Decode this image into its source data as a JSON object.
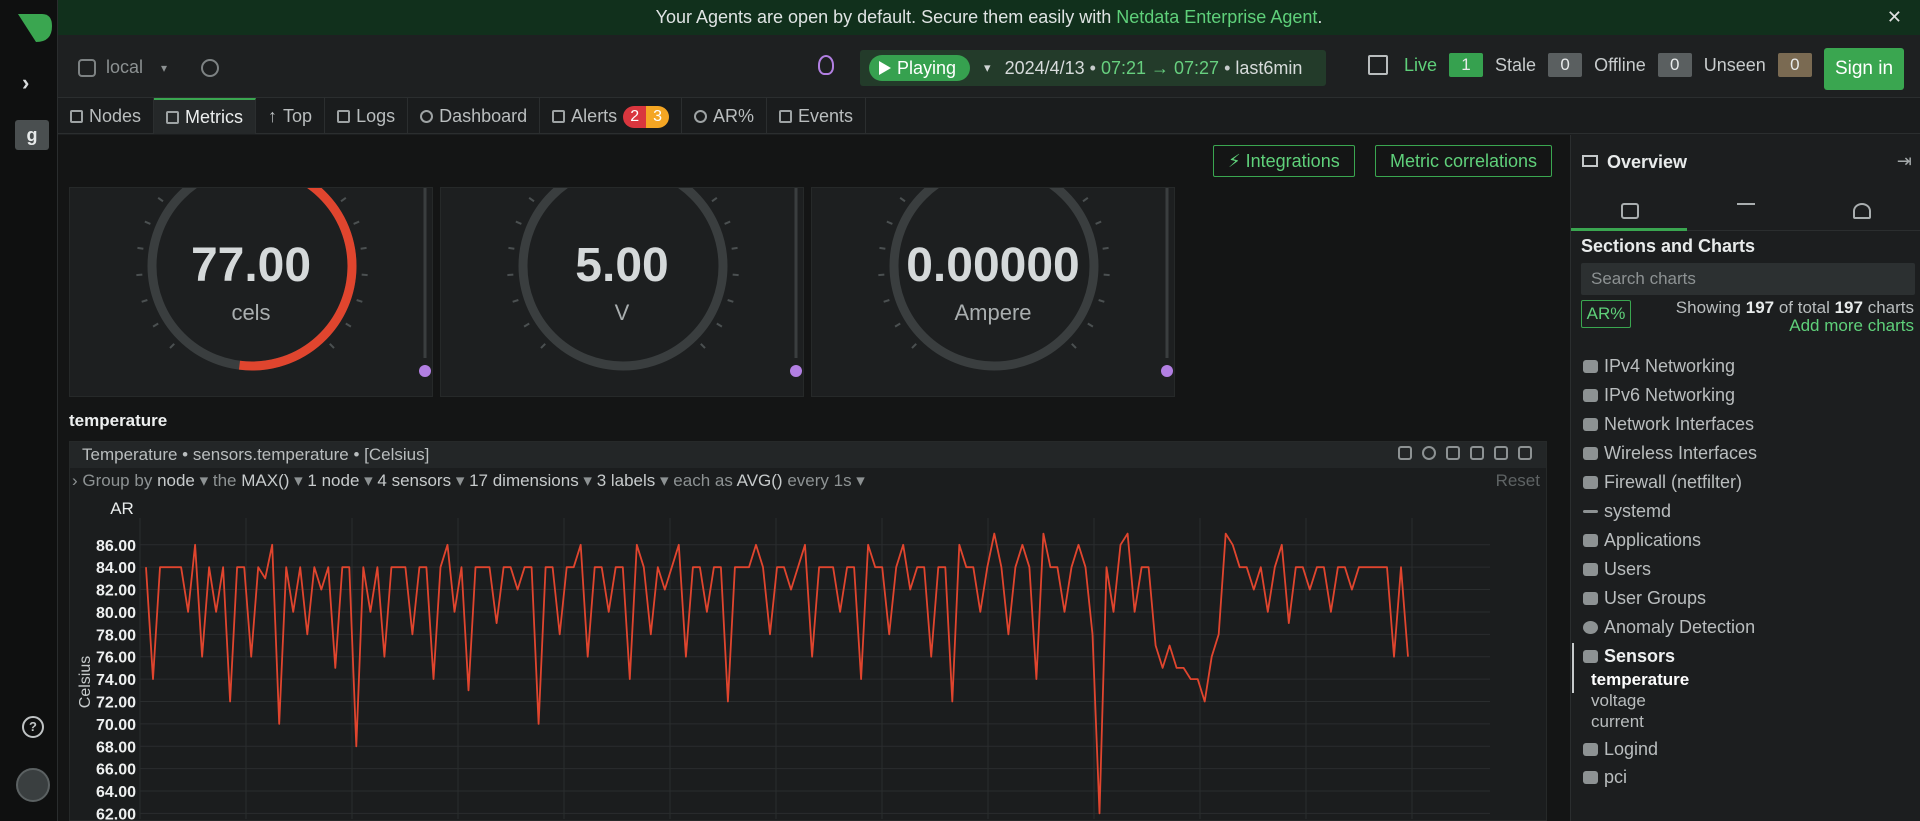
{
  "banner": {
    "text": "Your Agents are open by default. Secure them easily with ",
    "link": "Netdata Enterprise Agent",
    "suffix": ".",
    "close": "✕"
  },
  "rail": {
    "space_letter": "g",
    "help": "?"
  },
  "header": {
    "node_selector": "local",
    "play_label": "Playing",
    "date": "2024/4/13",
    "time_range": "07:21 → 07:27",
    "duration": "last6min",
    "status": [
      {
        "label": "Live",
        "count": "1",
        "color": "#36a14f"
      },
      {
        "label": "Stale",
        "count": "0",
        "color": "#5a5f60"
      },
      {
        "label": "Offline",
        "count": "0",
        "color": "#5a5f60"
      },
      {
        "label": "Unseen",
        "count": "0",
        "color": "#7a6a52"
      }
    ],
    "signin": "Sign in"
  },
  "tabs": [
    {
      "label": "Nodes"
    },
    {
      "label": "Metrics"
    },
    {
      "label": "Top"
    },
    {
      "label": "Logs"
    },
    {
      "label": "Dashboard"
    },
    {
      "label": "Alerts"
    },
    {
      "label": "AR%"
    },
    {
      "label": "Events"
    }
  ],
  "alerts": {
    "critical": "2",
    "warning": "3"
  },
  "toolbar": {
    "integrations": "Integrations",
    "metric_correlations": "Metric correlations"
  },
  "gauges": [
    {
      "value": "77.00",
      "unit": "cels",
      "fill": 0.52,
      "color": "#e0452e"
    },
    {
      "value": "5.00",
      "unit": "V",
      "fill": 0,
      "color": "#e0452e"
    },
    {
      "value": "0.00000",
      "unit": "Ampere",
      "fill": 0,
      "color": "#e0452e"
    }
  ],
  "section": "temperature",
  "chart": {
    "title": "Temperature • sensors.temperature • [Celsius]",
    "group": {
      "prefix": "Group by",
      "by": "node",
      "the": "the",
      "agg": "MAX()",
      "nodes": "1 node",
      "sensors": "4 sensors",
      "dims": "17 dimensions",
      "labels": "3 labels",
      "each": "each as",
      "avg": "AVG()",
      "every": "every 1s",
      "reset": "Reset"
    },
    "ar": "AR",
    "ylabel": "Celsius"
  },
  "chart_data": {
    "type": "line",
    "title": "Temperature • sensors.temperature • [Celsius]",
    "ylabel": "Celsius",
    "yticks": [
      "86.00",
      "84.00",
      "82.00",
      "80.00",
      "78.00",
      "76.00",
      "74.00",
      "72.00",
      "70.00",
      "68.00",
      "66.00",
      "64.00",
      "62.00"
    ],
    "ylim": [
      61.5,
      87.5
    ],
    "color": "#e0452e",
    "series": [
      {
        "values": [
          84,
          74,
          84,
          84,
          84,
          84,
          80,
          86,
          76,
          84,
          80,
          84,
          72,
          84,
          84,
          76,
          84,
          83,
          86,
          70,
          84,
          80,
          84,
          78,
          84,
          82,
          84,
          75,
          84,
          84,
          68,
          84,
          80,
          84,
          76,
          84,
          84,
          84,
          78,
          84,
          84,
          74,
          84,
          86,
          80,
          84,
          73,
          84,
          84,
          84,
          79,
          84,
          84,
          82,
          84,
          84,
          70,
          84,
          84,
          78,
          84,
          84,
          86,
          76,
          84,
          84,
          80,
          84,
          84,
          74,
          86,
          84,
          78,
          84,
          82,
          84,
          86,
          76,
          84,
          84,
          80,
          84,
          84,
          72,
          84,
          84,
          84,
          86,
          84,
          78,
          84,
          84,
          82,
          84,
          86,
          76,
          84,
          84,
          84,
          80,
          84,
          84,
          74,
          86,
          84,
          84,
          78,
          84,
          86,
          82,
          84,
          84,
          76,
          84,
          84,
          72,
          86,
          84,
          84,
          80,
          84,
          87,
          84,
          78,
          84,
          86,
          84,
          74,
          87,
          84,
          84,
          80,
          84,
          86,
          84,
          78,
          62,
          84,
          80,
          86,
          87,
          80,
          84,
          84,
          77,
          75,
          77,
          75,
          75,
          74,
          74,
          72,
          76,
          78,
          87,
          86,
          84,
          84,
          82,
          84,
          80,
          84,
          86,
          79,
          84,
          84,
          82,
          84,
          84,
          80,
          84,
          84,
          82,
          84,
          84,
          84,
          84,
          84,
          76,
          84,
          76
        ]
      }
    ]
  },
  "panel": {
    "title": "Overview",
    "collapse": "⇥",
    "sections_title": "Sections and Charts",
    "search_placeholder": "Search charts",
    "ar": "AR%",
    "showing_prefix": "Showing ",
    "showing_count": "197",
    "showing_mid": " of total ",
    "showing_total": "197",
    "showing_suffix": " charts",
    "add_more": "Add more charts",
    "items": [
      {
        "label": "IPv4 Networking"
      },
      {
        "label": "IPv6 Networking"
      },
      {
        "label": "Network Interfaces"
      },
      {
        "label": "Wireless Interfaces"
      },
      {
        "label": "Firewall (netfilter)"
      },
      {
        "label": "systemd"
      },
      {
        "label": "Applications"
      },
      {
        "label": "Users"
      },
      {
        "label": "User Groups"
      },
      {
        "label": "Anomaly Detection"
      },
      {
        "label": "Sensors"
      }
    ],
    "children": [
      {
        "label": "temperature"
      },
      {
        "label": "voltage"
      },
      {
        "label": "current"
      }
    ],
    "after": [
      {
        "label": "Logind"
      },
      {
        "label": "pci"
      }
    ]
  }
}
